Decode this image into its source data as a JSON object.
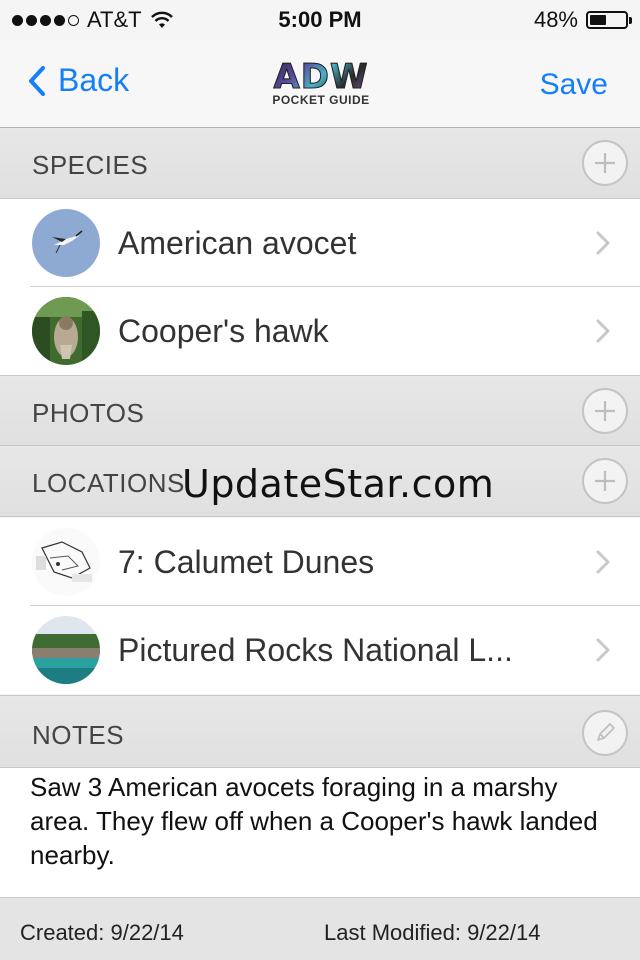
{
  "status_bar": {
    "carrier": "AT&T",
    "time": "5:00 PM",
    "battery": "48%",
    "battery_level": 0.48,
    "signal_bars": 4
  },
  "nav": {
    "back_label": "Back",
    "save_label": "Save",
    "logo_main": "ADW",
    "logo_sub": "POCKET GUIDE"
  },
  "sections": {
    "species": {
      "title": "SPECIES",
      "items": [
        {
          "label": "American avocet",
          "thumb": "avocet-photo"
        },
        {
          "label": "Cooper's hawk",
          "thumb": "hawk-photo"
        }
      ]
    },
    "photos": {
      "title": "PHOTOS"
    },
    "locations": {
      "title": "LOCATIONS",
      "items": [
        {
          "label": "7: Calumet Dunes",
          "thumb": "trail-map"
        },
        {
          "label": "Pictured Rocks National L...",
          "thumb": "lakeshore-photo"
        }
      ]
    },
    "notes": {
      "title": "NOTES",
      "text": "Saw 3 American avocets foraging in a marshy area. They flew off when a Cooper's hawk landed nearby."
    }
  },
  "watermark": "UpdateStar.com",
  "footer": {
    "created": "Created:  9/22/14",
    "modified": "Last Modified:  9/22/14"
  },
  "colors": {
    "accent": "#157efb",
    "header_bg": "#e4e4e4"
  }
}
